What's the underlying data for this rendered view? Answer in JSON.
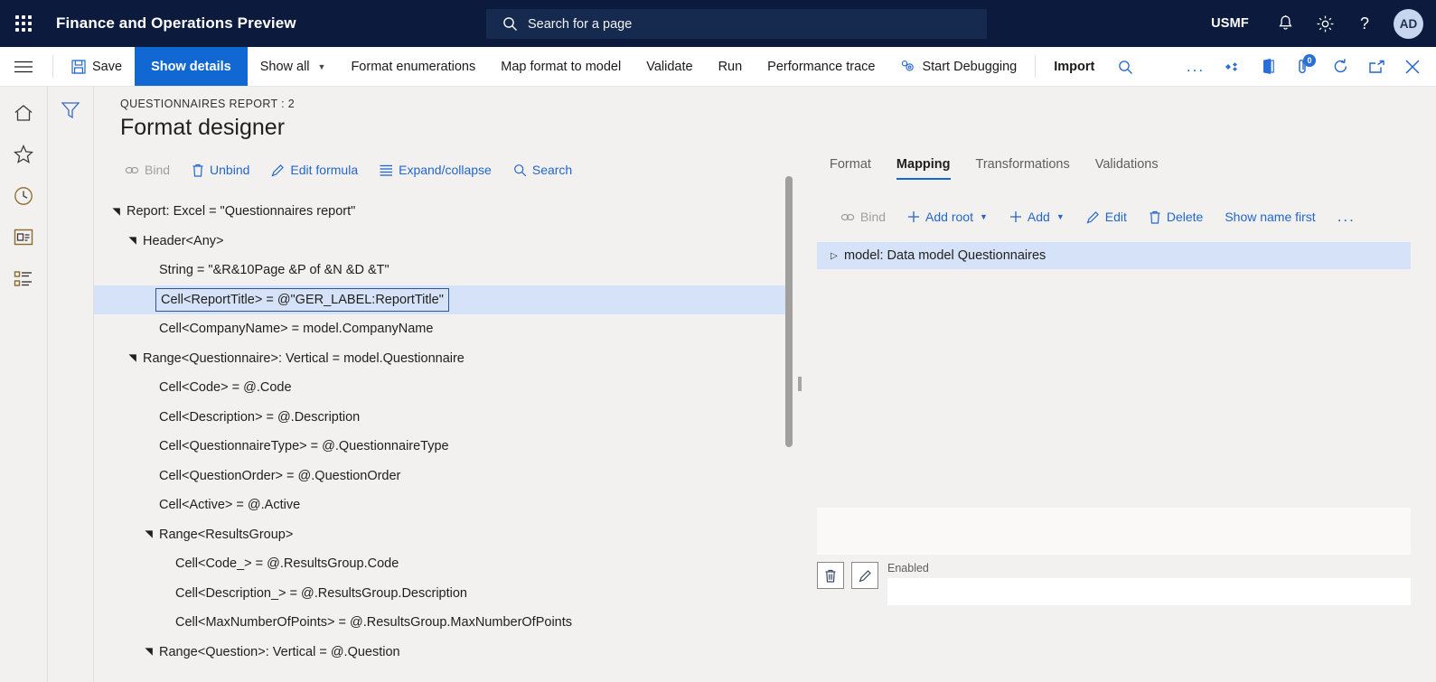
{
  "topbar": {
    "app_title": "Finance and Operations Preview",
    "waffle_icon": "app-launcher-icon",
    "search_placeholder": "Search for a page",
    "search_icon": "search-icon",
    "company": "USMF",
    "notifications_icon": "bell-icon",
    "settings_icon": "gear-icon",
    "help_icon": "question-mark-icon",
    "avatar_initials": "AD"
  },
  "actionbar": {
    "hamburger_icon": "hamburger-menu-icon",
    "save_label": "Save",
    "save_icon": "save-disk-icon",
    "show_details_label": "Show details",
    "show_all_label": "Show all",
    "format_enumerations_label": "Format enumerations",
    "map_format_to_model_label": "Map format to model",
    "validate_label": "Validate",
    "run_label": "Run",
    "performance_trace_label": "Performance trace",
    "start_debugging_label": "Start Debugging",
    "start_debugging_icon": "debug-gears-icon",
    "import_label": "Import",
    "search_icon": "search-icon",
    "overflow_label": "...",
    "office_icon": "office-apps-icon",
    "open_in_office_icon": "open-in-office-icon",
    "attachments_icon": "attachments-icon",
    "attachments_count": "0",
    "refresh_icon": "refresh-icon",
    "popout_icon": "pop-out-icon",
    "close_icon": "close-icon"
  },
  "rail": {
    "items": [
      {
        "icon": "home-icon",
        "name": "home"
      },
      {
        "icon": "star-icon",
        "name": "favorites"
      },
      {
        "icon": "clock-icon",
        "name": "recent"
      },
      {
        "icon": "workspace-icon",
        "name": "workspaces"
      },
      {
        "icon": "modules-list-icon",
        "name": "modules"
      }
    ],
    "filter_icon": "filter-funnel-icon"
  },
  "page": {
    "breadcrumb": "QUESTIONNAIRES REPORT : 2",
    "title": "Format designer"
  },
  "left_pane": {
    "toolbar": [
      {
        "label": "Bind",
        "icon": "bind-link-icon",
        "disabled": true
      },
      {
        "label": "Unbind",
        "icon": "trash-icon",
        "disabled": false
      },
      {
        "label": "Edit formula",
        "icon": "pencil-icon",
        "disabled": false
      },
      {
        "label": "Expand/collapse",
        "icon": "list-lines-icon",
        "disabled": false
      },
      {
        "label": "Search",
        "icon": "search-icon",
        "disabled": false
      }
    ],
    "tree": [
      {
        "label": "Report: Excel = \"Questionnaires report\"",
        "indent": 0,
        "twisty": "expanded",
        "selected": false
      },
      {
        "label": "Header<Any>",
        "indent": 1,
        "twisty": "expanded",
        "selected": false
      },
      {
        "label": "String = \"&R&10Page &P of &N &D &T\"",
        "indent": 2,
        "twisty": "none",
        "selected": false
      },
      {
        "label": "Cell<ReportTitle> = @\"GER_LABEL:ReportTitle\"",
        "indent": 2,
        "twisty": "none",
        "selected": true
      },
      {
        "label": "Cell<CompanyName> = model.CompanyName",
        "indent": 2,
        "twisty": "none",
        "selected": false
      },
      {
        "label": "Range<Questionnaire>: Vertical = model.Questionnaire",
        "indent": 1,
        "twisty": "expanded",
        "selected": false
      },
      {
        "label": "Cell<Code> = @.Code",
        "indent": 2,
        "twisty": "none",
        "selected": false
      },
      {
        "label": "Cell<Description> = @.Description",
        "indent": 2,
        "twisty": "none",
        "selected": false
      },
      {
        "label": "Cell<QuestionnaireType> = @.QuestionnaireType",
        "indent": 2,
        "twisty": "none",
        "selected": false
      },
      {
        "label": "Cell<QuestionOrder> = @.QuestionOrder",
        "indent": 2,
        "twisty": "none",
        "selected": false
      },
      {
        "label": "Cell<Active> = @.Active",
        "indent": 2,
        "twisty": "none",
        "selected": false
      },
      {
        "label": "Range<ResultsGroup>",
        "indent": 2,
        "twisty": "expanded",
        "selected": false
      },
      {
        "label": "Cell<Code_> = @.ResultsGroup.Code",
        "indent": 3,
        "twisty": "none",
        "selected": false
      },
      {
        "label": "Cell<Description_> = @.ResultsGroup.Description",
        "indent": 3,
        "twisty": "none",
        "selected": false
      },
      {
        "label": "Cell<MaxNumberOfPoints> = @.ResultsGroup.MaxNumberOfPoints",
        "indent": 3,
        "twisty": "none",
        "selected": false
      },
      {
        "label": "Range<Question>: Vertical = @.Question",
        "indent": 2,
        "twisty": "expanded",
        "selected": false
      }
    ]
  },
  "right_pane": {
    "tabs": [
      {
        "label": "Format",
        "active": false
      },
      {
        "label": "Mapping",
        "active": true
      },
      {
        "label": "Transformations",
        "active": false
      },
      {
        "label": "Validations",
        "active": false
      }
    ],
    "toolbar": [
      {
        "label": "Bind",
        "icon": "bind-link-icon",
        "disabled": true,
        "caret": false
      },
      {
        "label": "Add root",
        "icon": "plus-icon",
        "disabled": false,
        "caret": true
      },
      {
        "label": "Add",
        "icon": "plus-icon",
        "disabled": false,
        "caret": true
      },
      {
        "label": "Edit",
        "icon": "pencil-icon",
        "disabled": false,
        "caret": false
      },
      {
        "label": "Delete",
        "icon": "trash-icon",
        "disabled": false,
        "caret": false
      },
      {
        "label": "Show name first",
        "icon": "none",
        "disabled": false,
        "caret": false
      },
      {
        "label": "...",
        "icon": "none",
        "disabled": false,
        "caret": false
      }
    ],
    "tree": [
      {
        "label": "model: Data model Questionnaires",
        "twisty": "collapsed",
        "selected": true
      }
    ],
    "detail": {
      "delete_icon": "trash-icon",
      "edit_icon": "pencil-icon",
      "enabled_label": "Enabled",
      "enabled_value": ""
    }
  },
  "colors": {
    "topbar_bg": "#0b1a3d",
    "accent": "#1268d2",
    "selection": "#d6e2f8",
    "page_bg": "#f2f1f0",
    "link": "#2266cc"
  }
}
